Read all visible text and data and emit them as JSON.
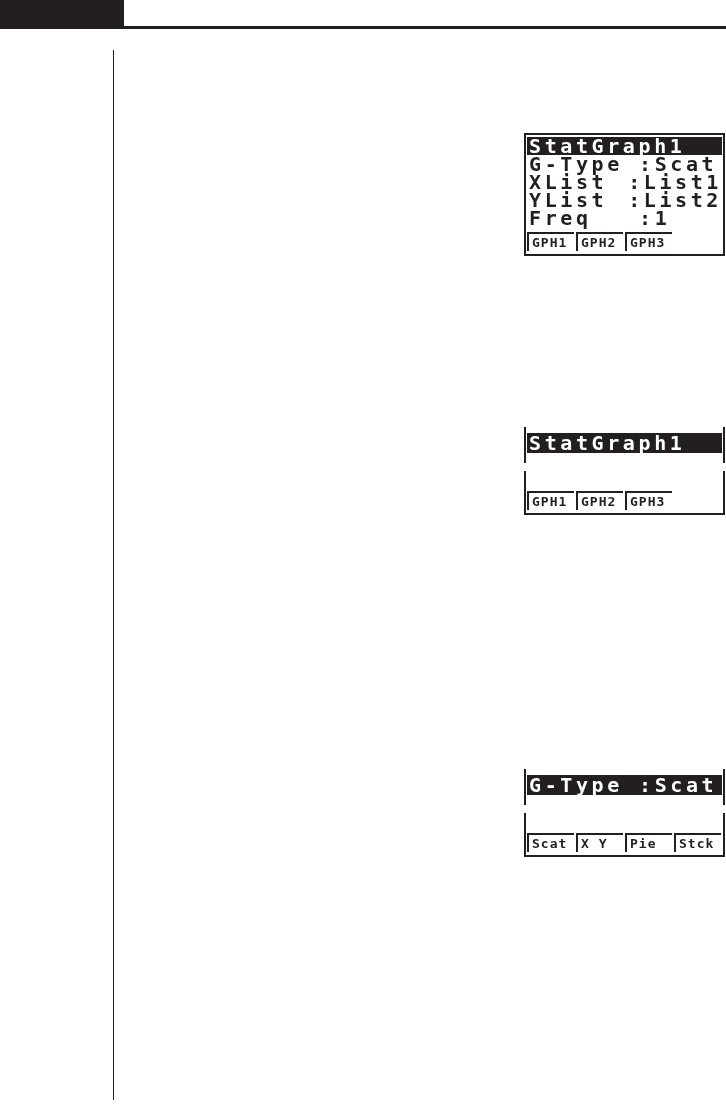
{
  "screens": [
    {
      "kind": "full",
      "rows": [
        {
          "label": "StatGraph1",
          "selected": true
        },
        {
          "label": "G-Type",
          "value": ":Scat",
          "selected": false
        },
        {
          "label": "XList",
          "value": ":List1",
          "selected": false
        },
        {
          "label": "YList",
          "value": ":List2",
          "selected": false
        },
        {
          "label": "Freq",
          "value": ":1",
          "selected": false
        }
      ],
      "menu": [
        "GPH1",
        "GPH2",
        "GPH3"
      ]
    },
    {
      "kind": "split",
      "rows": [
        {
          "label": "StatGraph1",
          "selected": true
        }
      ],
      "menu": [
        "GPH1",
        "GPH2",
        "GPH3"
      ]
    },
    {
      "kind": "split",
      "rows": [
        {
          "label": "G-Type",
          "value": ":Scat",
          "selected": true
        }
      ],
      "menu": [
        "Scat",
        "X Y",
        "Pie",
        "Stck"
      ]
    }
  ]
}
